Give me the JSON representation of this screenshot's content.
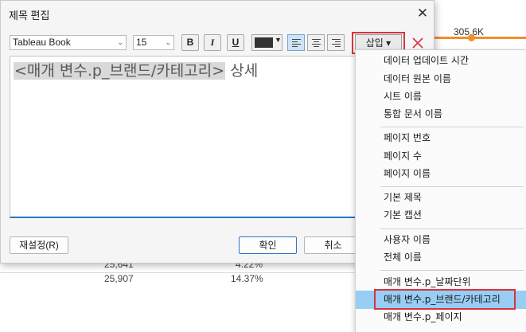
{
  "dialog": {
    "title": "제목 편집",
    "close_glyph": "✕",
    "toolbar": {
      "font_family": "Tableau Book",
      "font_size": "15",
      "bold_label": "B",
      "italic_label": "I",
      "underline_label": "U",
      "text_color": "#333333",
      "insert_label": "삽입 ▾"
    },
    "editor": {
      "token_text": "<매개 변수.p_브랜드/카테고리>",
      "trailing_text": " 상세"
    },
    "buttons": {
      "reset": "재설정(R)",
      "ok": "확인",
      "cancel": "취소"
    }
  },
  "insert_menu": {
    "groups": [
      [
        "데이터 업데이트 시간",
        "데이터 원본 이름",
        "시트 이름",
        "통합 문서 이름"
      ],
      [
        "페이지 번호",
        "페이지 수",
        "페이지 이름"
      ],
      [
        "기본 제목",
        "기본 캡션"
      ],
      [
        "사용자 이름",
        "전체 이름"
      ],
      [
        "매개 변수.p_날짜단위",
        "매개 변수.p_브랜드/카테고리",
        "매개 변수.p_페이지"
      ]
    ],
    "hovered_item": "매개 변수.p_브랜드/카테고리"
  },
  "background": {
    "chart_value": "305.6K",
    "rows": [
      {
        "value": "25,641",
        "pct": "4.22%"
      },
      {
        "value": "25,907",
        "pct": "14.37%"
      }
    ],
    "line_color": "#f28e2b"
  }
}
